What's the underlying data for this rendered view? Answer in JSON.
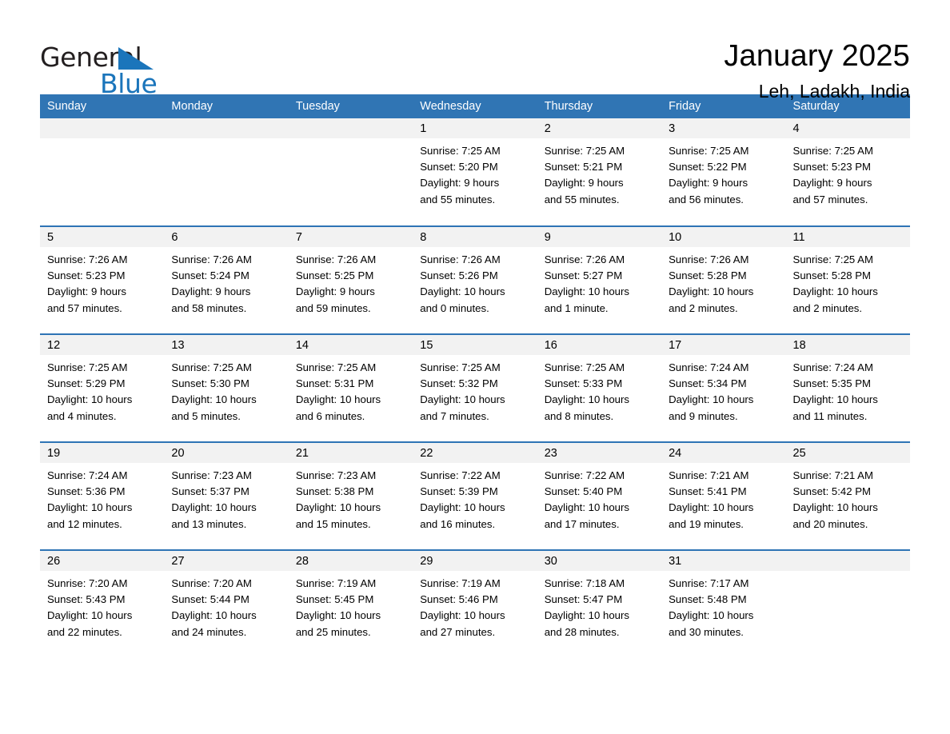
{
  "brand": {
    "name_part1": "General",
    "name_part2": "Blue",
    "flag_icon": "triangle-flag-icon",
    "accent_color": "#1b75bb"
  },
  "header": {
    "title": "January 2025",
    "location": "Leh, Ladakh, India"
  },
  "theme": {
    "header_bar_color": "#3075b4",
    "row_divider_color": "#2e74b5",
    "daynum_band_color": "#f2f2f2",
    "text_color": "#000000"
  },
  "calendar": {
    "weekday_headers": [
      "Sunday",
      "Monday",
      "Tuesday",
      "Wednesday",
      "Thursday",
      "Friday",
      "Saturday"
    ],
    "weeks": [
      [
        {
          "day": "",
          "empty": true
        },
        {
          "day": "",
          "empty": true
        },
        {
          "day": "",
          "empty": true
        },
        {
          "day": "1",
          "sunrise": "Sunrise: 7:25 AM",
          "sunset": "Sunset: 5:20 PM",
          "daylight_line1": "Daylight: 9 hours",
          "daylight_line2": "and 55 minutes."
        },
        {
          "day": "2",
          "sunrise": "Sunrise: 7:25 AM",
          "sunset": "Sunset: 5:21 PM",
          "daylight_line1": "Daylight: 9 hours",
          "daylight_line2": "and 55 minutes."
        },
        {
          "day": "3",
          "sunrise": "Sunrise: 7:25 AM",
          "sunset": "Sunset: 5:22 PM",
          "daylight_line1": "Daylight: 9 hours",
          "daylight_line2": "and 56 minutes."
        },
        {
          "day": "4",
          "sunrise": "Sunrise: 7:25 AM",
          "sunset": "Sunset: 5:23 PM",
          "daylight_line1": "Daylight: 9 hours",
          "daylight_line2": "and 57 minutes."
        }
      ],
      [
        {
          "day": "5",
          "sunrise": "Sunrise: 7:26 AM",
          "sunset": "Sunset: 5:23 PM",
          "daylight_line1": "Daylight: 9 hours",
          "daylight_line2": "and 57 minutes."
        },
        {
          "day": "6",
          "sunrise": "Sunrise: 7:26 AM",
          "sunset": "Sunset: 5:24 PM",
          "daylight_line1": "Daylight: 9 hours",
          "daylight_line2": "and 58 minutes."
        },
        {
          "day": "7",
          "sunrise": "Sunrise: 7:26 AM",
          "sunset": "Sunset: 5:25 PM",
          "daylight_line1": "Daylight: 9 hours",
          "daylight_line2": "and 59 minutes."
        },
        {
          "day": "8",
          "sunrise": "Sunrise: 7:26 AM",
          "sunset": "Sunset: 5:26 PM",
          "daylight_line1": "Daylight: 10 hours",
          "daylight_line2": "and 0 minutes."
        },
        {
          "day": "9",
          "sunrise": "Sunrise: 7:26 AM",
          "sunset": "Sunset: 5:27 PM",
          "daylight_line1": "Daylight: 10 hours",
          "daylight_line2": "and 1 minute."
        },
        {
          "day": "10",
          "sunrise": "Sunrise: 7:26 AM",
          "sunset": "Sunset: 5:28 PM",
          "daylight_line1": "Daylight: 10 hours",
          "daylight_line2": "and 2 minutes."
        },
        {
          "day": "11",
          "sunrise": "Sunrise: 7:25 AM",
          "sunset": "Sunset: 5:28 PM",
          "daylight_line1": "Daylight: 10 hours",
          "daylight_line2": "and 2 minutes."
        }
      ],
      [
        {
          "day": "12",
          "sunrise": "Sunrise: 7:25 AM",
          "sunset": "Sunset: 5:29 PM",
          "daylight_line1": "Daylight: 10 hours",
          "daylight_line2": "and 4 minutes."
        },
        {
          "day": "13",
          "sunrise": "Sunrise: 7:25 AM",
          "sunset": "Sunset: 5:30 PM",
          "daylight_line1": "Daylight: 10 hours",
          "daylight_line2": "and 5 minutes."
        },
        {
          "day": "14",
          "sunrise": "Sunrise: 7:25 AM",
          "sunset": "Sunset: 5:31 PM",
          "daylight_line1": "Daylight: 10 hours",
          "daylight_line2": "and 6 minutes."
        },
        {
          "day": "15",
          "sunrise": "Sunrise: 7:25 AM",
          "sunset": "Sunset: 5:32 PM",
          "daylight_line1": "Daylight: 10 hours",
          "daylight_line2": "and 7 minutes."
        },
        {
          "day": "16",
          "sunrise": "Sunrise: 7:25 AM",
          "sunset": "Sunset: 5:33 PM",
          "daylight_line1": "Daylight: 10 hours",
          "daylight_line2": "and 8 minutes."
        },
        {
          "day": "17",
          "sunrise": "Sunrise: 7:24 AM",
          "sunset": "Sunset: 5:34 PM",
          "daylight_line1": "Daylight: 10 hours",
          "daylight_line2": "and 9 minutes."
        },
        {
          "day": "18",
          "sunrise": "Sunrise: 7:24 AM",
          "sunset": "Sunset: 5:35 PM",
          "daylight_line1": "Daylight: 10 hours",
          "daylight_line2": "and 11 minutes."
        }
      ],
      [
        {
          "day": "19",
          "sunrise": "Sunrise: 7:24 AM",
          "sunset": "Sunset: 5:36 PM",
          "daylight_line1": "Daylight: 10 hours",
          "daylight_line2": "and 12 minutes."
        },
        {
          "day": "20",
          "sunrise": "Sunrise: 7:23 AM",
          "sunset": "Sunset: 5:37 PM",
          "daylight_line1": "Daylight: 10 hours",
          "daylight_line2": "and 13 minutes."
        },
        {
          "day": "21",
          "sunrise": "Sunrise: 7:23 AM",
          "sunset": "Sunset: 5:38 PM",
          "daylight_line1": "Daylight: 10 hours",
          "daylight_line2": "and 15 minutes."
        },
        {
          "day": "22",
          "sunrise": "Sunrise: 7:22 AM",
          "sunset": "Sunset: 5:39 PM",
          "daylight_line1": "Daylight: 10 hours",
          "daylight_line2": "and 16 minutes."
        },
        {
          "day": "23",
          "sunrise": "Sunrise: 7:22 AM",
          "sunset": "Sunset: 5:40 PM",
          "daylight_line1": "Daylight: 10 hours",
          "daylight_line2": "and 17 minutes."
        },
        {
          "day": "24",
          "sunrise": "Sunrise: 7:21 AM",
          "sunset": "Sunset: 5:41 PM",
          "daylight_line1": "Daylight: 10 hours",
          "daylight_line2": "and 19 minutes."
        },
        {
          "day": "25",
          "sunrise": "Sunrise: 7:21 AM",
          "sunset": "Sunset: 5:42 PM",
          "daylight_line1": "Daylight: 10 hours",
          "daylight_line2": "and 20 minutes."
        }
      ],
      [
        {
          "day": "26",
          "sunrise": "Sunrise: 7:20 AM",
          "sunset": "Sunset: 5:43 PM",
          "daylight_line1": "Daylight: 10 hours",
          "daylight_line2": "and 22 minutes."
        },
        {
          "day": "27",
          "sunrise": "Sunrise: 7:20 AM",
          "sunset": "Sunset: 5:44 PM",
          "daylight_line1": "Daylight: 10 hours",
          "daylight_line2": "and 24 minutes."
        },
        {
          "day": "28",
          "sunrise": "Sunrise: 7:19 AM",
          "sunset": "Sunset: 5:45 PM",
          "daylight_line1": "Daylight: 10 hours",
          "daylight_line2": "and 25 minutes."
        },
        {
          "day": "29",
          "sunrise": "Sunrise: 7:19 AM",
          "sunset": "Sunset: 5:46 PM",
          "daylight_line1": "Daylight: 10 hours",
          "daylight_line2": "and 27 minutes."
        },
        {
          "day": "30",
          "sunrise": "Sunrise: 7:18 AM",
          "sunset": "Sunset: 5:47 PM",
          "daylight_line1": "Daylight: 10 hours",
          "daylight_line2": "and 28 minutes."
        },
        {
          "day": "31",
          "sunrise": "Sunrise: 7:17 AM",
          "sunset": "Sunset: 5:48 PM",
          "daylight_line1": "Daylight: 10 hours",
          "daylight_line2": "and 30 minutes."
        },
        {
          "day": "",
          "empty": true
        }
      ]
    ]
  }
}
